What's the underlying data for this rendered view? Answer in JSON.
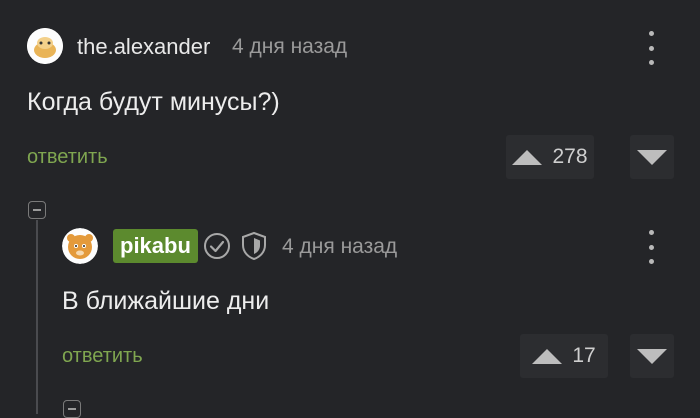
{
  "comments": [
    {
      "author": "the.alexander",
      "time": "4 дня назад",
      "text": "Когда будут минусы?)",
      "reply_label": "ответить",
      "votes": "278"
    },
    {
      "author": "pikabu",
      "time": "4 дня назад",
      "text": "В ближайшие дни",
      "reply_label": "ответить",
      "votes": "17",
      "icons": [
        "verified-check-icon",
        "shield-icon"
      ]
    }
  ],
  "colors": {
    "background": "#242528",
    "accent_green": "#7fa650",
    "badge_green": "#5c8a2e"
  }
}
